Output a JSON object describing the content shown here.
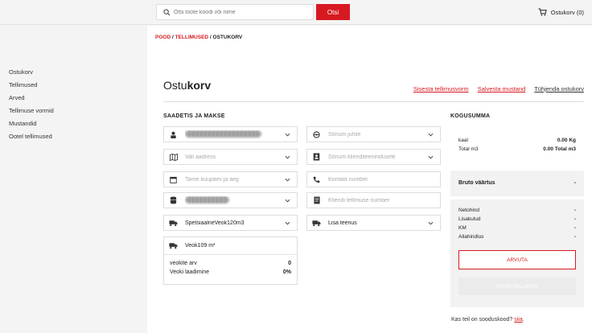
{
  "search": {
    "placeholder": "Otsi toote koodi või nime",
    "button_label": "Otsi"
  },
  "cart": {
    "label": "Ostukorv (0)"
  },
  "sidebar": {
    "items": [
      {
        "label": "Ostukorv"
      },
      {
        "label": "Tellimused"
      },
      {
        "label": "Arved"
      },
      {
        "label": "Tellimuse vormid"
      },
      {
        "label": "Mustandid"
      },
      {
        "label": "Ootel tellimused"
      }
    ]
  },
  "breadcrumb": {
    "pood": "POOD",
    "sep1": " / ",
    "tellimused": "TELLIMUSED",
    "sep2": " / ",
    "current": "OSTUKORV"
  },
  "page": {
    "title_light": "Ostu",
    "title_bold": "korv"
  },
  "actions": {
    "sisesta": "Sisesta tellimusvorm",
    "salvesta": "Salvesta mustand",
    "tuhjenda": "Tühjenda ostukorv"
  },
  "shipment": {
    "title": "SAADETIS JA MAKSE",
    "address_placeholder": "Vali aadress",
    "date_placeholder": "Tarne kuupäev ja aeg",
    "vehicle_type": "SpetsiaalneVeok120m3"
  },
  "right_fields": {
    "driver_message": "Sõnum juhile",
    "customer_message": "Sõnum klienditeenindusele",
    "contact_number": "Kontakt number",
    "order_number": "Kliendi tellimuse number",
    "add_service": "Lisa teenus"
  },
  "vehicle": {
    "name": "Veok109 m³",
    "rows": [
      {
        "label": "veokite arv",
        "value": "0"
      },
      {
        "label": "Veoki laadimine",
        "value": "0%"
      }
    ]
  },
  "total": {
    "title": "KOGUSUMMA",
    "rows": [
      {
        "label": "kaal",
        "value": "0.00 Kg"
      },
      {
        "label": "Total m3",
        "value": "0.00 Total m3"
      }
    ]
  },
  "bruto": {
    "label": "Bruto väärtus",
    "value": "-",
    "rows": [
      {
        "label": "Netohind",
        "value": "-"
      },
      {
        "label": "Lisakulud",
        "value": "-"
      },
      {
        "label": "KM",
        "value": "-"
      },
      {
        "label": "Allahindlus",
        "value": "-"
      }
    ],
    "calc_button": "ARVUTA",
    "submit_button": "ESITA TELLIMUS"
  },
  "promo": {
    "text": "Kas teil on sooduskood? ",
    "link": "siia",
    "end": "."
  },
  "colors": {
    "accent": "#d71920",
    "border": "#dddddd",
    "panel": "#f2f2f2"
  }
}
